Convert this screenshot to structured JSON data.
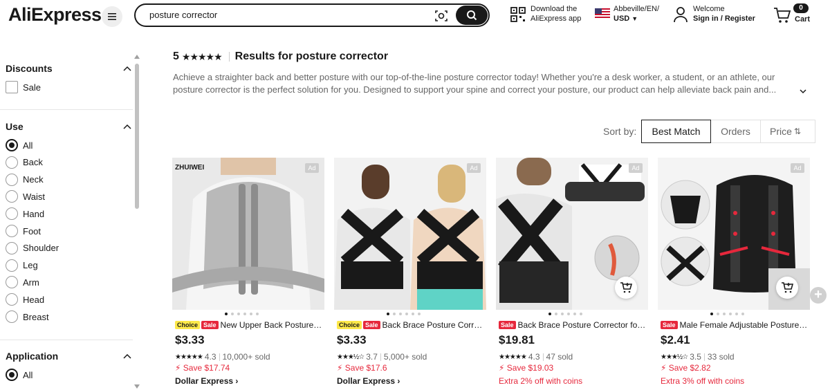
{
  "header": {
    "logo": "AliExpress",
    "search_value": "posture corrector",
    "download_line1": "Download the",
    "download_line2": "AliExpress app",
    "locale_line1": "Abbeville/EN/",
    "locale_line2": "USD",
    "welcome_line1": "Welcome",
    "welcome_line2": "Sign in / Register",
    "cart_label": "Cart",
    "cart_count": "0"
  },
  "sidebar": {
    "discounts": {
      "title": "Discounts",
      "options": [
        {
          "label": "Sale",
          "checked": false
        }
      ]
    },
    "use": {
      "title": "Use",
      "options": [
        "All",
        "Back",
        "Neck",
        "Waist",
        "Hand",
        "Foot",
        "Shoulder",
        "Leg",
        "Arm",
        "Head",
        "Breast"
      ],
      "selected": "All"
    },
    "application": {
      "title": "Application",
      "options": [
        "All"
      ],
      "selected": "All"
    }
  },
  "results": {
    "count": "5",
    "stars": "★★★★★",
    "title": "Results for posture corrector",
    "description": "Achieve a straighter back and better posture with our top-of-the-line posture corrector today! Whether you're a desk worker, a student, or an athlete, our posture corrector is the perfect solution for you. Designed to support your spine and correct your posture, our product can help alleviate back pain and..."
  },
  "sort": {
    "label": "Sort by:",
    "options": [
      "Best Match",
      "Orders",
      "Price"
    ],
    "active": "Best Match"
  },
  "products": [
    {
      "brand": "ZHUIWEI",
      "ad": "Ad",
      "choice": "Choice",
      "sale": "Sale",
      "title": "New Upper Back Posture Corrector",
      "price": "$3.33",
      "stars": "★★★★★",
      "rating": "4.3",
      "sold": "10,000+ sold",
      "save": "Save $17.74",
      "extra": "Dollar Express ›",
      "extra_red": false
    },
    {
      "ad": "Ad",
      "choice": "Choice",
      "sale": "Sale",
      "title": "Back Brace Posture Corrector",
      "price": "$3.33",
      "stars": "★★★½☆",
      "rating": "3.7",
      "sold": "5,000+ sold",
      "save": "Save $17.6",
      "extra": "Dollar Express ›",
      "extra_red": false
    },
    {
      "ad": "Ad",
      "choice": "",
      "sale": "Sale",
      "title": "Back Brace Posture Corrector for Men",
      "price": "$19.81",
      "stars": "★★★★★",
      "rating": "4.3",
      "sold": "47 sold",
      "save": "Save $19.03",
      "extra": "Extra 2% off with coins",
      "extra_red": true
    },
    {
      "ad": "Ad",
      "choice": "",
      "sale": "Sale",
      "title": "Male Female Adjustable Posture Corrector",
      "price": "$2.41",
      "stars": "★★★½☆",
      "rating": "3.5",
      "sold": "33 sold",
      "save": "Save $2.82",
      "extra": "Extra 3% off with coins",
      "extra_red": true
    }
  ],
  "colors": {
    "sale_red": "#e6283c",
    "choice_yellow": "#fde84a",
    "text": "#191919"
  },
  "icons": [
    "menu-icon",
    "camera-search-icon",
    "search-icon",
    "qr-code-icon",
    "us-flag-icon",
    "user-icon",
    "cart-icon",
    "chevron-up-icon",
    "add-to-cart-icon",
    "plus-icon",
    "sort-price-icon"
  ]
}
